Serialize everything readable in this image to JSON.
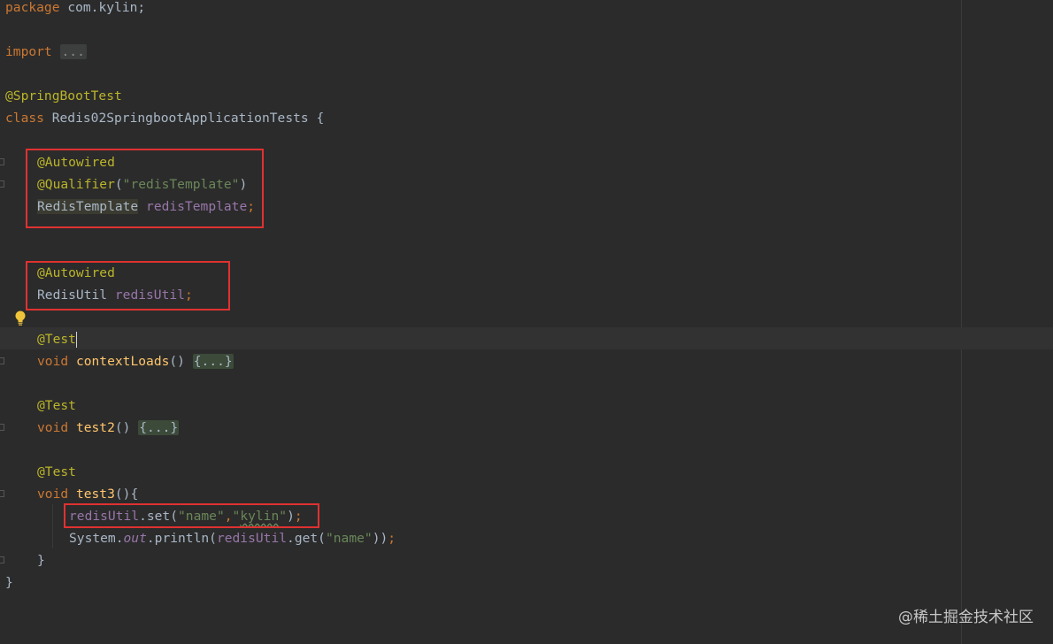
{
  "code": {
    "package_kw": "package",
    "package_name": "com.kylin;",
    "import_kw": "import",
    "import_fold": "...",
    "class_annotation": "@SpringBootTest",
    "class_kw": "class",
    "class_decl": "Redis02SpringbootApplicationTests {",
    "autowired_1": "@Autowired",
    "qualifier_ann": "@Qualifier",
    "qualifier_value": "\"redisTemplate\"",
    "template_type": "RedisTemplate",
    "template_field": "redisTemplate",
    "autowired_2": "@Autowired",
    "util_type": "RedisUtil",
    "util_field": "redisUtil",
    "test_ann_1": "@Test",
    "void_1": "void",
    "method_1": "contextLoads",
    "fold_1": "{...}",
    "test_ann_2": "@Test",
    "void_2": "void",
    "method_2": "test2",
    "fold_2": "{...}",
    "test_ann_3": "@Test",
    "void_3": "void",
    "method_3": "test3",
    "set_receiver": "redisUtil",
    "set_call": ".set(",
    "set_key": "\"name\"",
    "set_value_open": "\"",
    "set_value_word": "kylin",
    "set_value_close": "\"",
    "get_system": "System.",
    "get_out": "out",
    "get_println": ".println(",
    "get_receiver": "redisUtil",
    "get_call": ".get(",
    "get_key": "\"name\"",
    "close_method": "}",
    "close_class": "}"
  },
  "watermark": "@稀土掘金技术社区",
  "colors": {
    "background": "#2b2b2b",
    "keyword": "#cc7832",
    "annotation": "#bbb529",
    "string": "#6a8759",
    "field": "#9876aa",
    "highlight_box": "#e03131"
  }
}
